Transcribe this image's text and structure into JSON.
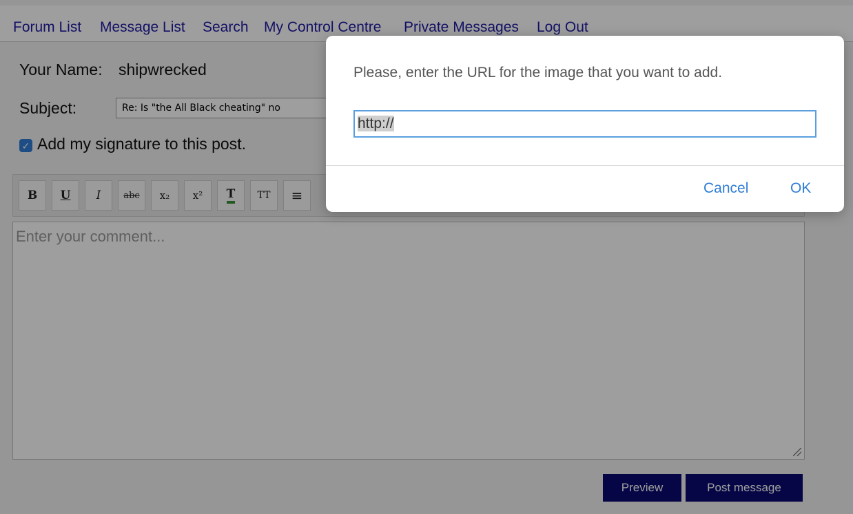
{
  "nav": {
    "items": [
      "Forum List",
      "Message List",
      "Search",
      "My Control Centre",
      "Private Messages",
      "Log Out"
    ]
  },
  "form": {
    "name_label": "Your Name:",
    "name_value": "shipwrecked",
    "subject_label": "Subject:",
    "subject_value": "Re: Is \"the All Black cheating\" no",
    "signature_label": "Add my signature to this post.",
    "signature_checked": true,
    "comment_placeholder": "Enter your comment..."
  },
  "toolbar": {
    "buttons": [
      {
        "icon": "bold-icon",
        "glyph": "B"
      },
      {
        "icon": "underline-icon",
        "glyph": "U"
      },
      {
        "icon": "italic-icon",
        "glyph": "I"
      },
      {
        "icon": "strikethrough-icon",
        "glyph": "abc"
      },
      {
        "icon": "subscript-icon",
        "glyph": "x₂"
      },
      {
        "icon": "superscript-icon",
        "glyph": "x²"
      },
      {
        "icon": "text-color-icon",
        "glyph": "T"
      },
      {
        "icon": "font-size-icon",
        "glyph": "TT"
      },
      {
        "icon": "align-center-icon",
        "glyph": "≡"
      }
    ]
  },
  "actions": {
    "preview": "Preview",
    "post": "Post message"
  },
  "dialog": {
    "message": "Please, enter the URL for the image that you want to add.",
    "input_value": "http://",
    "cancel": "Cancel",
    "ok": "OK"
  },
  "colors": {
    "link": "#1f1aa3",
    "button_bg": "#0b0b72",
    "accent": "#2f7dd6"
  }
}
